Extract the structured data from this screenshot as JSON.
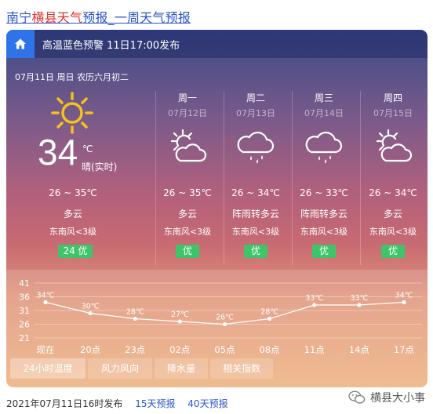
{
  "header": {
    "title_part1": "南宁",
    "title_highlight": "横县天气",
    "title_part2": "预报_一周天气预报"
  },
  "warning": {
    "text": "高温蓝色预警 11日17:00发布"
  },
  "today": {
    "date_line": "07月11日 周日 农历六月初二",
    "temp_now": "34",
    "unit": "℃",
    "condition_now": "晴(实时)",
    "range": "26 ~ 35℃",
    "desc": "多云",
    "wind": "东南风<3级",
    "aqi": "24  优",
    "icon": "sun-icon"
  },
  "forecast": [
    {
      "dow": "周一",
      "date": "07月12日",
      "range": "26 ~ 35℃",
      "desc": "多云",
      "wind": "东南风<3级",
      "aqi": "优",
      "icon": "partly-cloudy-icon"
    },
    {
      "dow": "周二",
      "date": "07月13日",
      "range": "26 ~ 34℃",
      "desc": "阵雨转多云",
      "wind": "东南风<3级",
      "aqi": "优",
      "icon": "rain-cloud-icon"
    },
    {
      "dow": "周三",
      "date": "07月14日",
      "range": "26 ~ 33℃",
      "desc": "阵雨转多云",
      "wind": "东南风<3级",
      "aqi": "优",
      "icon": "rain-cloud-icon"
    },
    {
      "dow": "周四",
      "date": "07月15日",
      "range": "26 ~ 34℃",
      "desc": "多云",
      "wind": "东南风<3级",
      "aqi": "优",
      "icon": "partly-cloudy-icon"
    }
  ],
  "chart_data": {
    "type": "line",
    "categories": [
      "现在",
      "20点",
      "23点",
      "02点",
      "05点",
      "08点",
      "11点",
      "14点",
      "17点"
    ],
    "series": [
      {
        "values": [
          34,
          30,
          28,
          27,
          26,
          28,
          33,
          33,
          34
        ]
      }
    ],
    "data_labels": [
      "34℃",
      "30℃",
      "28℃",
      "27℃",
      "26℃",
      "28℃",
      "33℃",
      "33℃",
      "34℃"
    ],
    "y_ticks": [
      "41",
      "36",
      "31",
      "26",
      "21"
    ],
    "ylim": [
      21,
      41
    ],
    "grid": true
  },
  "tabs": [
    "24小时温度",
    "风力风向",
    "降水量",
    "相关指数"
  ],
  "footer": {
    "published": "2021年07月11日16时发布",
    "link_15": "15天预报",
    "link_40": "40天预报"
  },
  "watermark": {
    "text": "横县大小事"
  },
  "colors": {
    "aqi_good": "#3fc46a",
    "link": "#2b55c9",
    "highlight": "#e0352b",
    "home_button": "#2f73e8"
  }
}
